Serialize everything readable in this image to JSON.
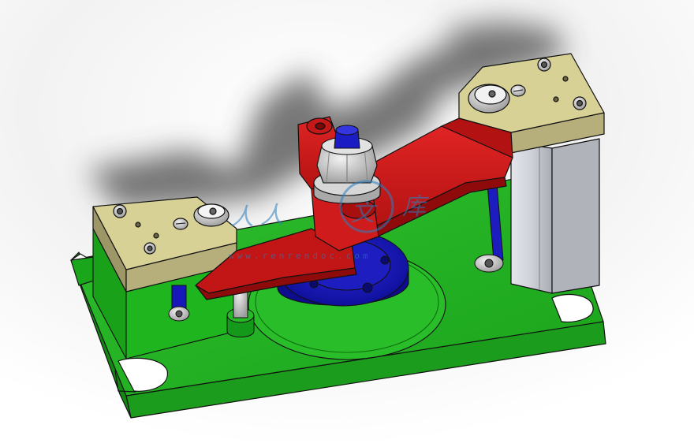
{
  "scene": {
    "subject": "3D CAD model of a fixture assembly",
    "colors": {
      "background_top": "#c9c9c9",
      "background": "#ffffff",
      "base_plate": "#22b022",
      "base_plate_side": "#0f7d0f",
      "arm": "#d41c1c",
      "arm_dark": "#9e0c0c",
      "hub": "#1616c8",
      "hub_dark": "#0a0a86",
      "block_top": "#d6cf94",
      "block_side": "#a9a373",
      "column": "#d2d4dc",
      "column_dark": "#a7a9b2",
      "steel": "#bcbcbc",
      "outline": "#111111"
    }
  },
  "watermark": {
    "logo_text": "人人文库",
    "url_text": "www.renrendoc.com",
    "color": "#2a7fc0"
  }
}
